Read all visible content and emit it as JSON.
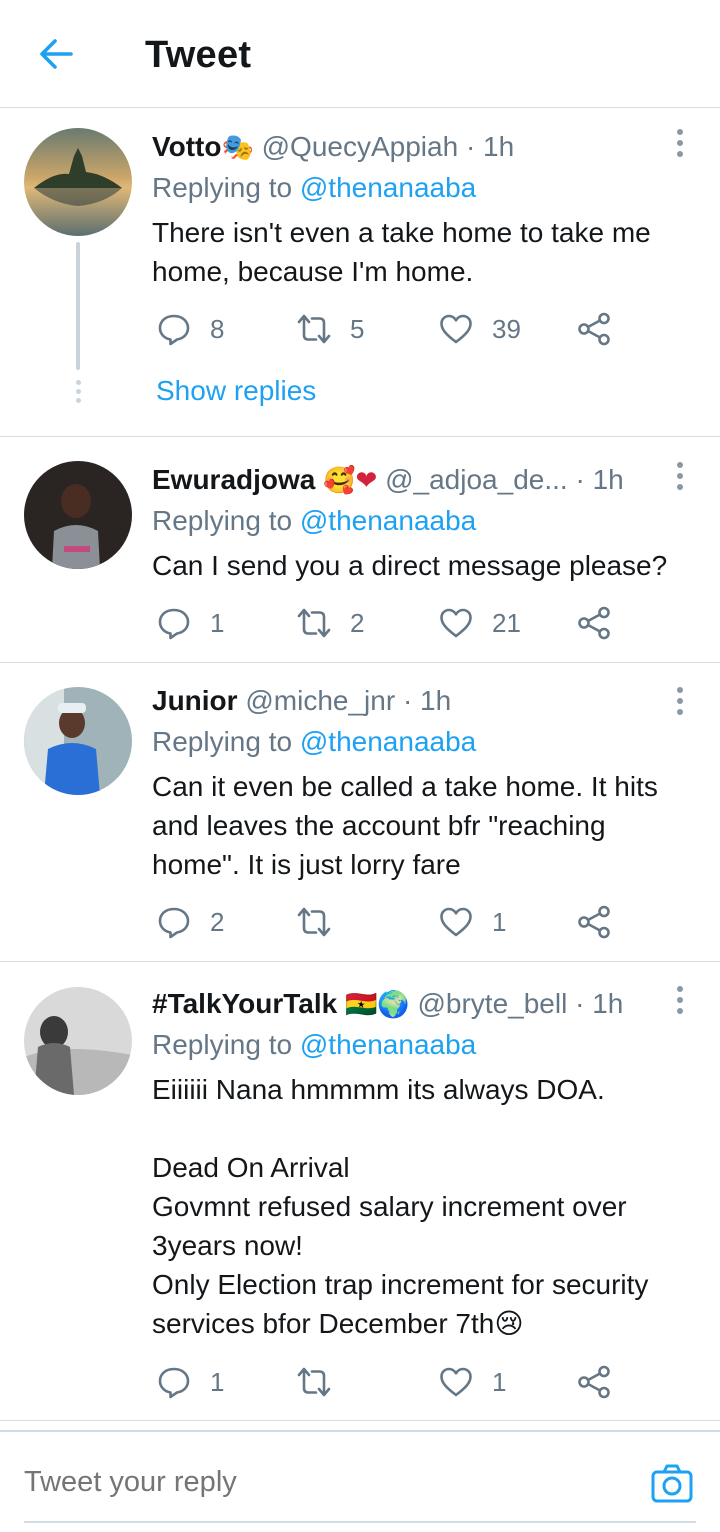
{
  "header": {
    "title": "Tweet"
  },
  "thread": {
    "show_replies": "Show replies"
  },
  "tweets": [
    {
      "name": "Votto",
      "name_emoji": "🎭",
      "handle": "@QuecyAppiah",
      "dot": "·",
      "time": "1h",
      "replying_prefix": "Replying to",
      "replying_to": "@thenanaaba",
      "text": "There isn't even a take home to take me home, because I'm home.",
      "replies": "8",
      "retweets": "5",
      "likes": "39"
    },
    {
      "name": "Ewuradjowa",
      "name_emoji": "🥰❤",
      "handle": "@_adjoa_de...",
      "dot": "·",
      "time": "1h",
      "replying_prefix": "Replying to",
      "replying_to": "@thenanaaba",
      "text": "Can I send you a direct message please?",
      "replies": "1",
      "retweets": "2",
      "likes": "21"
    },
    {
      "name": "Junior",
      "name_emoji": "",
      "handle": "@miche_jnr",
      "dot": "·",
      "time": "1h",
      "replying_prefix": "Replying to",
      "replying_to": "@thenanaaba",
      "text": "Can it even be called a take home. It hits and leaves the account bfr \"reaching home\". It is just lorry fare",
      "replies": "2",
      "retweets": "",
      "likes": "1"
    },
    {
      "name": "#TalkYourTalk",
      "name_emoji": "🇬🇭🌍",
      "handle": "@bryte_bell",
      "dot": "·",
      "time": "1h",
      "replying_prefix": "Replying to",
      "replying_to": "@thenanaaba",
      "text": "Eiiiiii Nana hmmmm its always DOA.\n\nDead On Arrival\nGovmnt refused salary increment over 3years now!\nOnly Election trap increment for security services bfor December 7th😢",
      "replies": "1",
      "retweets": "",
      "likes": "1"
    }
  ],
  "composer": {
    "placeholder": "Tweet your reply"
  },
  "colors": {
    "accent": "#1da1f2",
    "text": "#14171a",
    "muted": "#657786",
    "divider": "#d8dde2"
  },
  "icons": {
    "back": "arrow-left-icon",
    "more": "more-vertical-icon",
    "reply": "reply-bubble-icon",
    "retweet": "retweet-icon",
    "like": "heart-icon",
    "share": "share-icon",
    "camera": "camera-icon"
  }
}
